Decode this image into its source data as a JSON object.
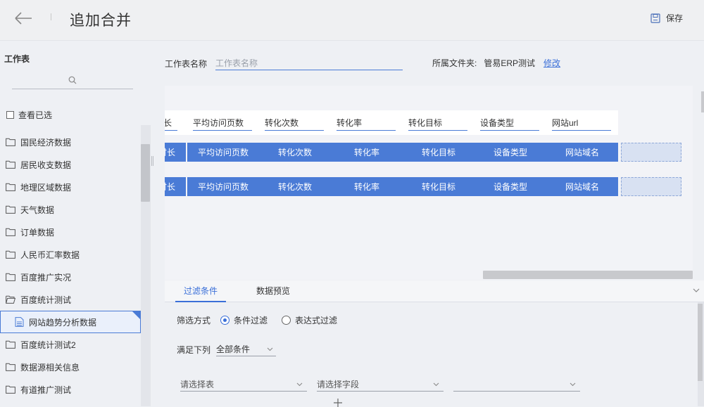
{
  "header": {
    "title": "追加合并",
    "save_label": "保存"
  },
  "sidebar": {
    "title": "工作表",
    "show_selected_label": "查看已选",
    "items": [
      {
        "label": "国民经济数据",
        "type": "folder"
      },
      {
        "label": "居民收支数据",
        "type": "folder"
      },
      {
        "label": "地理区域数据",
        "type": "folder"
      },
      {
        "label": "天气数据",
        "type": "folder"
      },
      {
        "label": "订单数据",
        "type": "folder"
      },
      {
        "label": "人民币汇率数据",
        "type": "folder"
      },
      {
        "label": "百度推广实况",
        "type": "folder"
      },
      {
        "label": "百度统计测试",
        "type": "folder-open"
      },
      {
        "label": "网站趋势分析数据",
        "type": "table",
        "selected": true
      },
      {
        "label": "百度统计测试2",
        "type": "folder"
      },
      {
        "label": "数据源相关信息",
        "type": "folder"
      },
      {
        "label": "有道推广测试",
        "type": "folder"
      }
    ]
  },
  "form": {
    "name_label": "工作表名称",
    "name_placeholder": "工作表名称",
    "folder_label": "所属文件夹:",
    "folder_value": "管易ERP测试",
    "edit_label": "修改"
  },
  "grid": {
    "headers": [
      "长",
      "平均访问页数",
      "转化次数",
      "转化率",
      "转化目标",
      "设备类型",
      "网站url"
    ],
    "row1": [
      "时长",
      "平均访问页数",
      "转化次数",
      "转化率",
      "转化目标",
      "设备类型",
      "网站域名"
    ],
    "row2": [
      "时长",
      "平均访问页数",
      "转化次数",
      "转化率",
      "转化目标",
      "设备类型",
      "网站域名"
    ]
  },
  "bottom": {
    "tabs": [
      "过滤条件",
      "数据预览"
    ],
    "filter_mode_label": "筛选方式",
    "option_condition": "条件过滤",
    "option_expression": "表达式过滤",
    "meet_label": "满足下列",
    "meet_value": "全部条件",
    "select_table_placeholder": "请选择表",
    "select_field_placeholder": "请选择字段",
    "select_value_placeholder": ""
  },
  "colors": {
    "accent": "#4a7bd6",
    "link": "#3a6fd8"
  }
}
